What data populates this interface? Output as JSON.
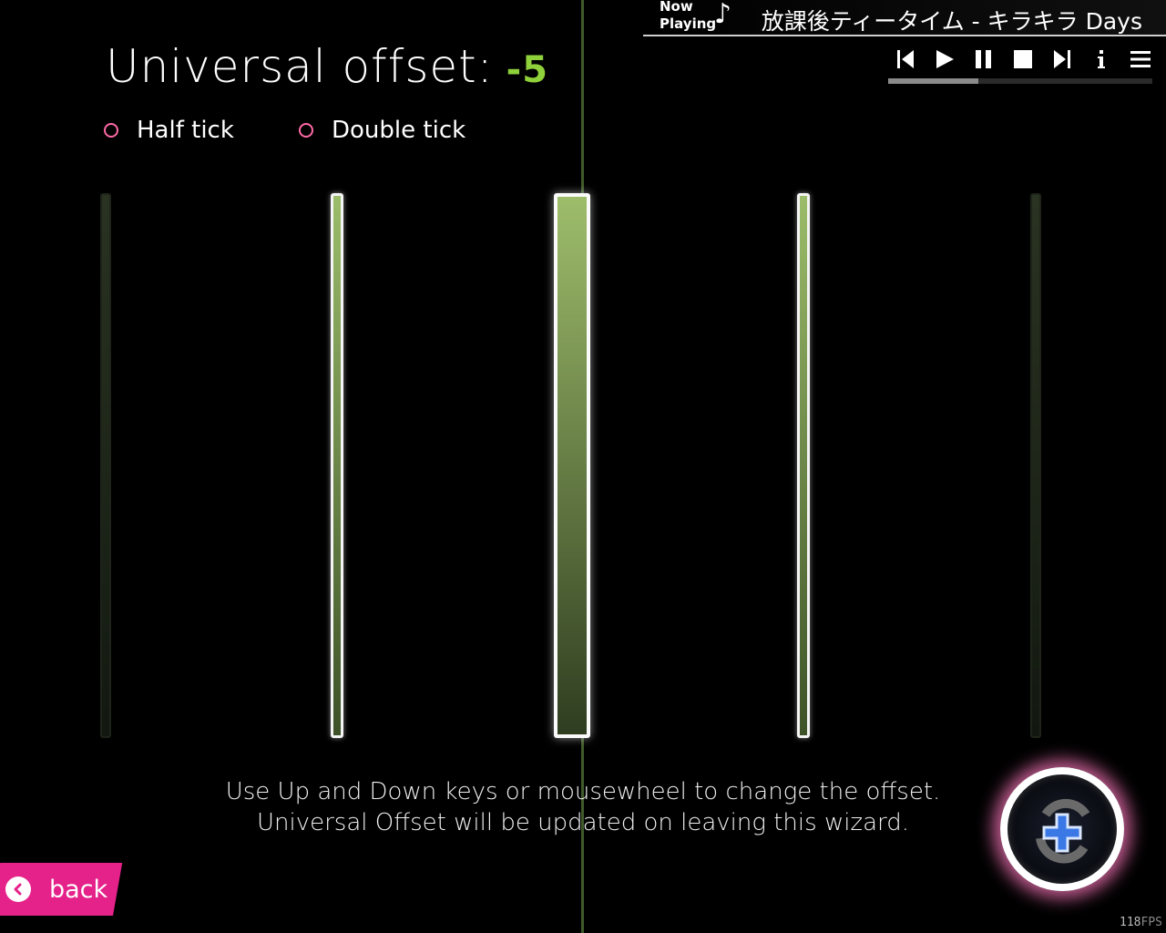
{
  "title": {
    "label": "Universal offset:",
    "value": "-5"
  },
  "options": [
    {
      "label": "Half tick"
    },
    {
      "label": "Double tick"
    }
  ],
  "instructions": {
    "line1": "Use Up and Down keys or mousewheel to change the offset.",
    "line2": "Universal Offset will be updated on leaving this wizard."
  },
  "now_playing": {
    "label_line1": "Now",
    "label_line2": "Playing",
    "note": "♪",
    "title": "放課後ティータイム - キラキラ Days",
    "progress": 0.34
  },
  "controls": [
    "previous-icon",
    "play-icon",
    "pause-icon",
    "stop-icon",
    "next-icon",
    "info-icon",
    "menu-icon"
  ],
  "back": {
    "label": "back"
  },
  "fps": {
    "value": "118",
    "unit": "FPS"
  },
  "colors": {
    "accent_green": "#8fd13a",
    "accent_pink": "#e5218a",
    "radio_pink": "#ff6aa6"
  }
}
